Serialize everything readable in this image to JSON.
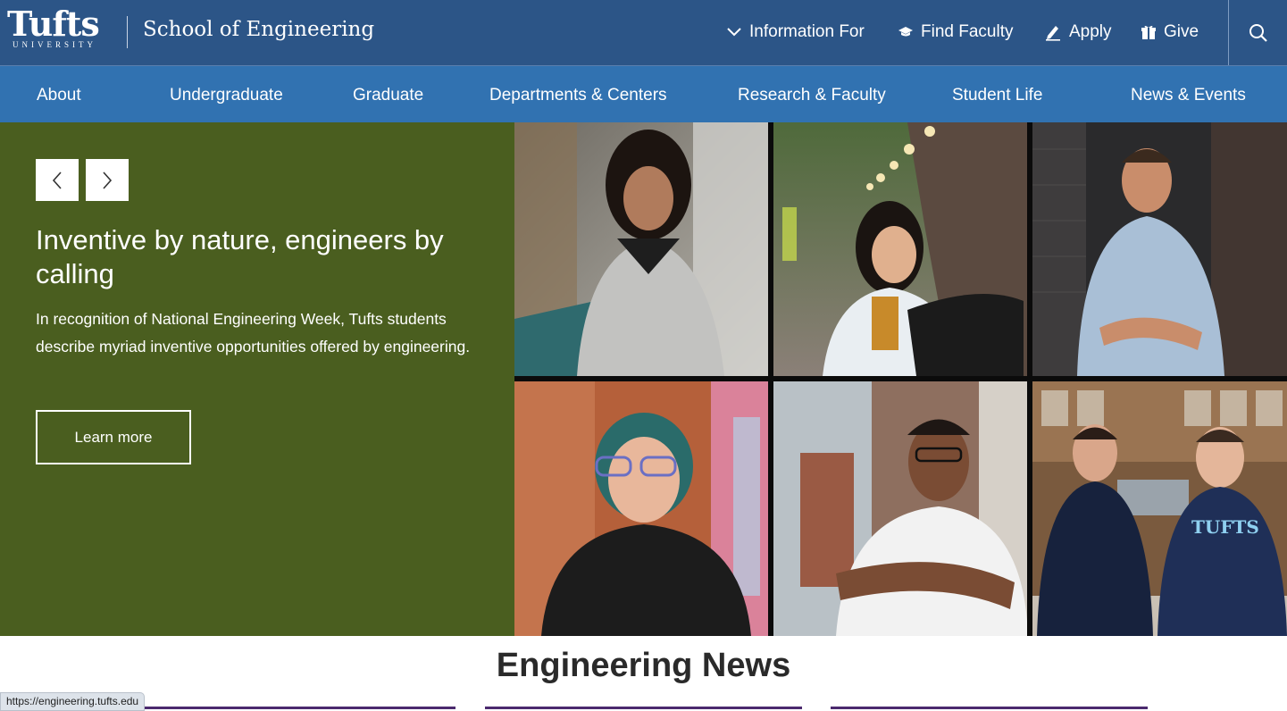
{
  "header": {
    "logo_text": "Tufts",
    "logo_subtext": "UNIVERSITY",
    "school_name": "School of Engineering",
    "utility_nav": [
      {
        "label": "Information For",
        "icon": "chevron-down-icon"
      },
      {
        "label": "Find Faculty",
        "icon": "graduation-cap-icon"
      },
      {
        "label": "Apply",
        "icon": "pencil-icon"
      },
      {
        "label": "Give",
        "icon": "gift-icon"
      }
    ],
    "search_icon": "search-icon"
  },
  "main_nav": {
    "items": [
      "About",
      "Undergraduate",
      "Graduate",
      "Departments & Centers",
      "Research & Faculty",
      "Student Life",
      "News & Events"
    ]
  },
  "hero": {
    "prev_icon": "chevron-left-icon",
    "next_icon": "chevron-right-icon",
    "title": "Inventive by nature, engineers by calling",
    "description": "In recognition of National Engineering Week, Tufts students describe myriad inventive opportunities offered by engineering.",
    "button_label": "Learn more"
  },
  "news": {
    "heading": "Engineering News"
  },
  "status_bar": {
    "url": "https://engineering.tufts.edu"
  },
  "colors": {
    "header_blue": "#2c5587",
    "nav_blue": "#3172b1",
    "hero_green": "#4a5e1f",
    "news_underline": "#4b2a6e"
  }
}
